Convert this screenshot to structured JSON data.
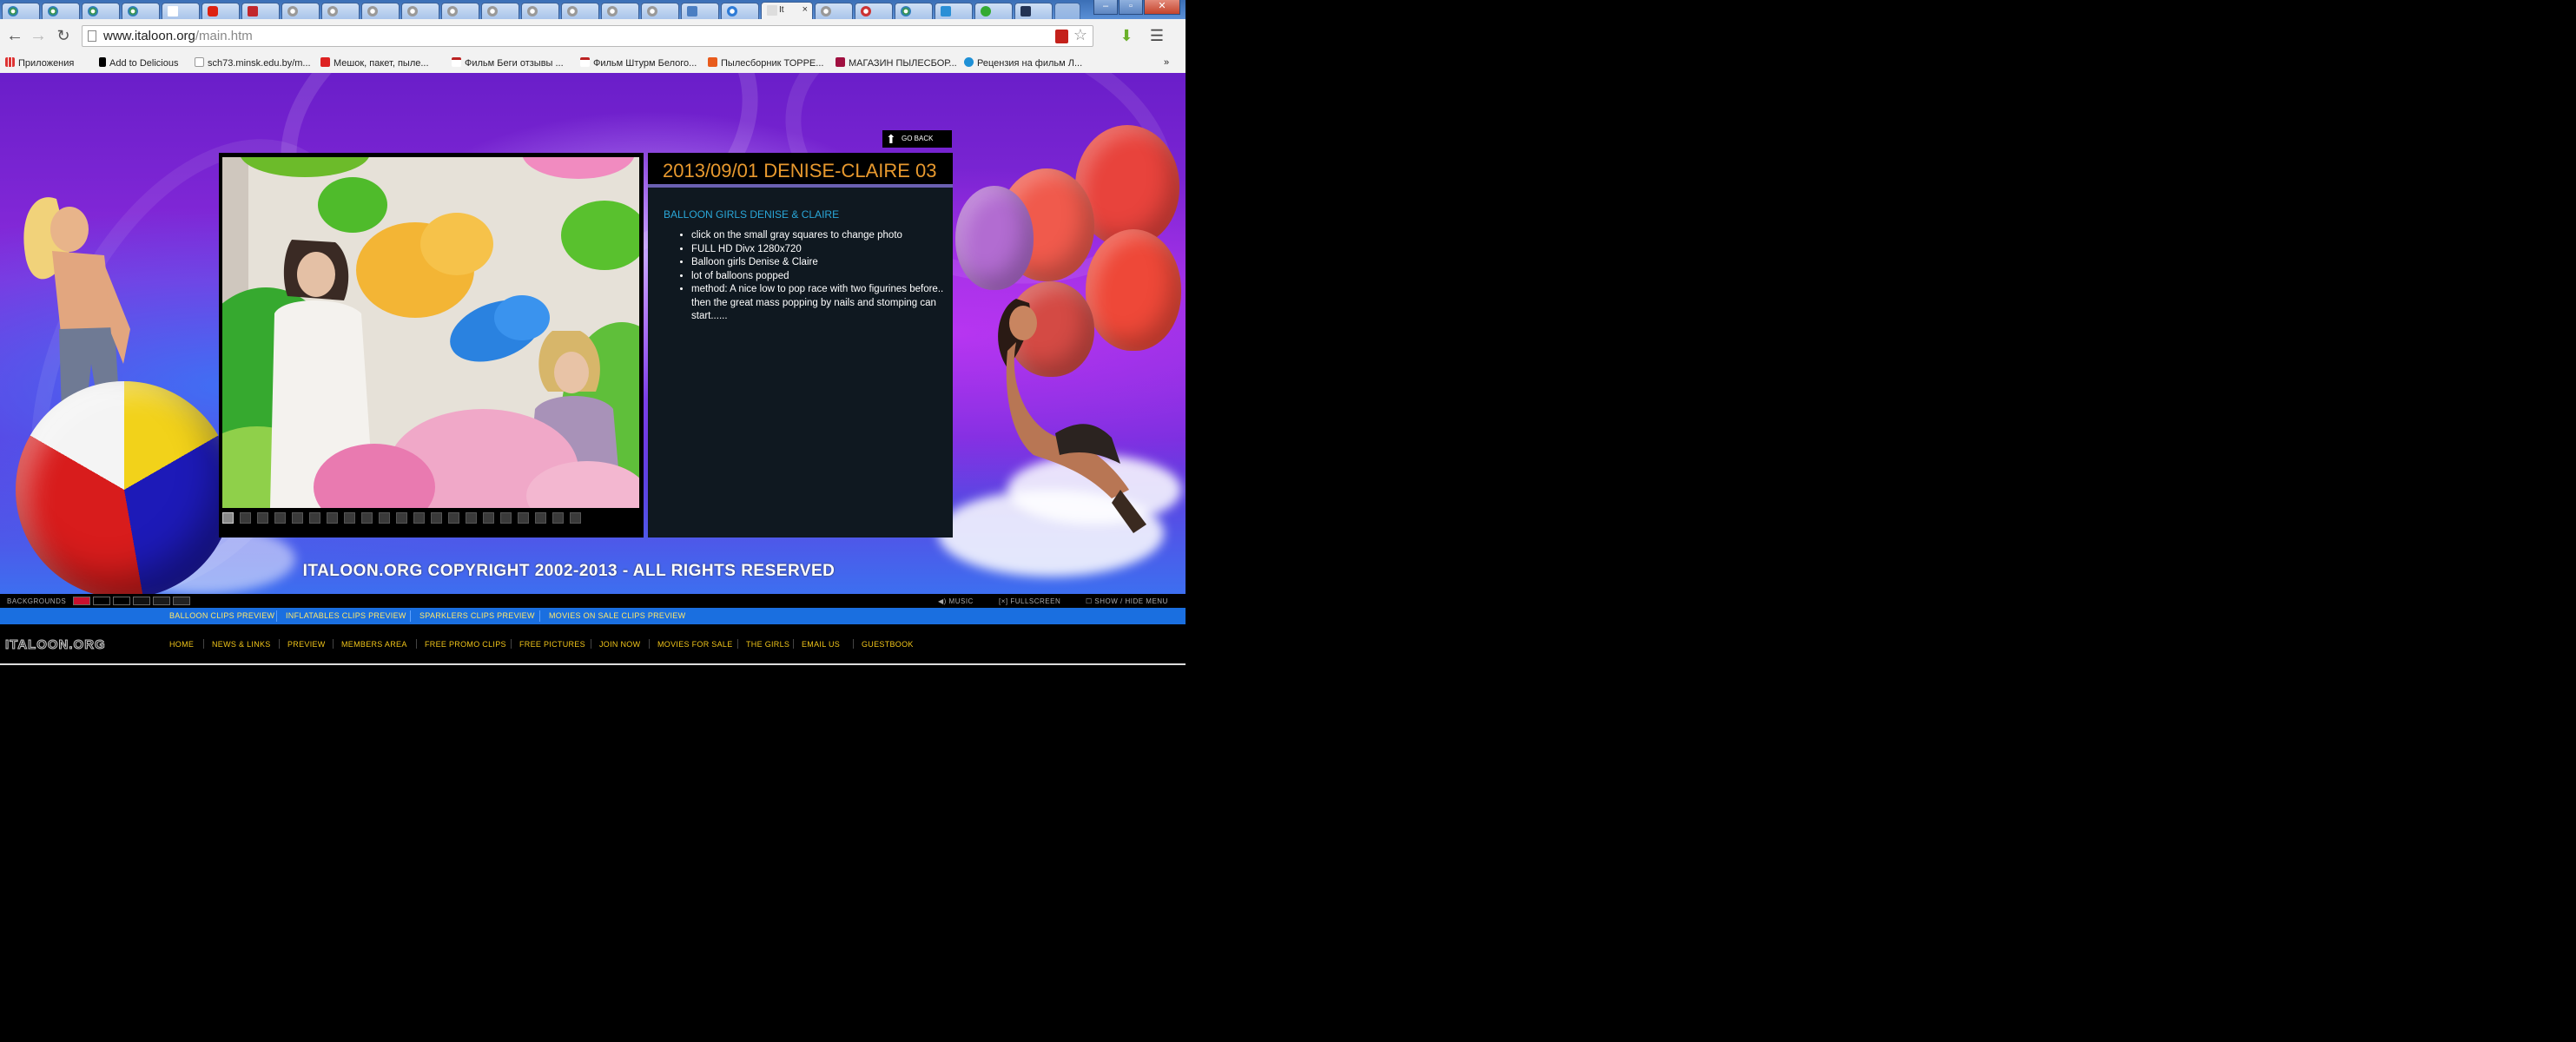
{
  "browser": {
    "active_tab_title": "It",
    "url_host": "www.italoon.org",
    "url_path": "/main.htm",
    "bookmarks": [
      {
        "label": "Приложения",
        "icon": "apps-grid-icon"
      },
      {
        "label": "Add to Delicious",
        "icon": "delicious-icon"
      },
      {
        "label": "sch73.minsk.edu.by/m...",
        "icon": "page-icon"
      },
      {
        "label": "Мешок, пакет, пыле...",
        "icon": "bookmark-icon"
      },
      {
        "label": "Фильм Беги отзывы ...",
        "icon": "gmail-icon"
      },
      {
        "label": "Фильм Штурм Белого...",
        "icon": "gmail-icon"
      },
      {
        "label": "Пылесборник ТОРРЕ...",
        "icon": "bookmark-icon"
      },
      {
        "label": "МАГАЗИН ПЫЛЕСБОР...",
        "icon": "bookmark-icon"
      },
      {
        "label": "Рецензия на фильм Л...",
        "icon": "ie-icon"
      }
    ],
    "bookmarks_overflow": "»"
  },
  "page": {
    "go_back_label": "GO BACK",
    "title": "2013/09/01 DENISE-CLAIRE 03",
    "subtitle": "BALLOON GIRLS DENISE & CLAIRE",
    "bullets": [
      "click on the small gray squares to change photo",
      "FULL HD Divx 1280x720",
      "Balloon girls Denise & Claire",
      "lot of balloons popped",
      "method: A nice low to pop race with two figurines before.. then the great mass popping by nails and stomping can start......"
    ],
    "thumbnail_count": 21,
    "selected_thumbnail": 1,
    "copyright": "ITALOON.ORG COPYRIGHT 2002-2013 - ALL RIGHTS RESERVED"
  },
  "backgrounds_bar": {
    "label": "BACKGROUNDS",
    "swatches": [
      "#c8102e",
      "#000000",
      "#000000",
      "#111111",
      "#1a1a1a",
      "#222222"
    ],
    "music_label": "MUSIC",
    "fullscreen_label": "FULLSCREEN",
    "menu_toggle_label": "SHOW / HIDE MENU"
  },
  "categories": [
    "BALLOON CLIPS PREVIEW",
    "INFLATABLES CLIPS PREVIEW",
    "SPARKLERS CLIPS PREVIEW",
    "MOVIES ON SALE CLIPS PREVIEW"
  ],
  "menu": {
    "logo": "ITALOON.ORG",
    "items": [
      "HOME",
      "NEWS & LINKS",
      "PREVIEW",
      "MEMBERS AREA",
      "FREE PROMO CLIPS",
      "FREE PICTURES",
      "JOIN NOW",
      "MOVIES FOR SALE",
      "THE GIRLS",
      "EMAIL US",
      "GUESTBOOK"
    ]
  }
}
